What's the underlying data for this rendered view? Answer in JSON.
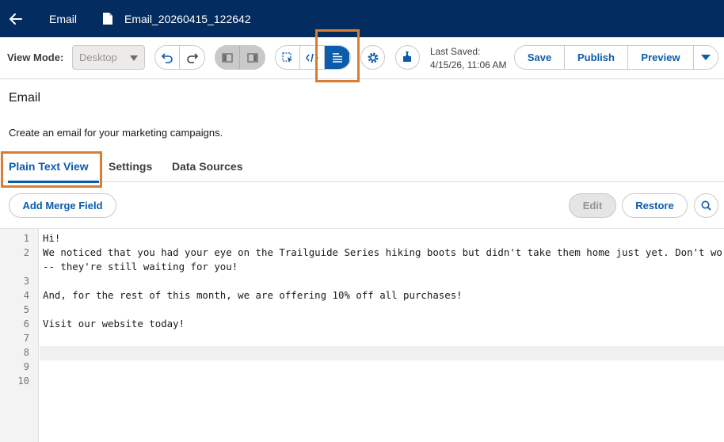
{
  "header": {
    "section_title": "Email",
    "file_name": "Email_20260415_122642"
  },
  "toolbar": {
    "view_mode_label": "View Mode:",
    "view_mode_value": "Desktop",
    "last_saved_label": "Last Saved:",
    "last_saved_value": "4/15/26, 11:06 AM",
    "save_label": "Save",
    "publish_label": "Publish",
    "preview_label": "Preview"
  },
  "page": {
    "title": "Email",
    "description": "Create an email for your marketing campaigns."
  },
  "tabs": [
    {
      "label": "Plain Text View",
      "active": true
    },
    {
      "label": "Settings",
      "active": false
    },
    {
      "label": "Data Sources",
      "active": false
    }
  ],
  "editor_bar": {
    "add_merge_field_label": "Add Merge Field",
    "edit_label": "Edit",
    "restore_label": "Restore"
  },
  "editor": {
    "line_numbers": [
      "1",
      "2",
      "3",
      "4",
      "5",
      "6",
      "7",
      "8",
      "9",
      "10"
    ],
    "lines": [
      "Hi!",
      "We noticed that you had your eye on the Trailguide Series hiking boots but didn't take them home just yet. Don't worry",
      "-- they're still waiting for you!",
      "",
      "And, for the rest of this month, we are offering 10% off all purchases!",
      "",
      "Visit our website today!",
      "",
      "",
      "",
      ""
    ]
  },
  "colors": {
    "header_bg": "#032d60",
    "brand_blue": "#0b5cab",
    "highlight_orange": "#d97d32"
  },
  "icons": [
    "back-arrow-icon",
    "document-icon",
    "undo-icon",
    "redo-icon",
    "left-panel-icon",
    "right-panel-icon",
    "select-icon",
    "code-icon",
    "text-view-icon",
    "gear-icon",
    "puzzle-icon",
    "chevron-down-icon",
    "search-icon"
  ]
}
